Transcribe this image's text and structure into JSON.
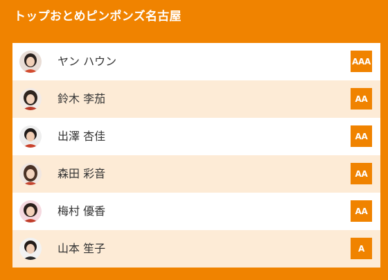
{
  "team": {
    "title": "トップおとめピンポンズ名古屋"
  },
  "players": [
    {
      "name": "ヤン ハウン",
      "rank": "AAA",
      "avatar_icon": "player-photo-icon"
    },
    {
      "name": "鈴木 李茄",
      "rank": "AA",
      "avatar_icon": "player-photo-icon"
    },
    {
      "name": "出澤 杏佳",
      "rank": "AA",
      "avatar_icon": "player-photo-icon"
    },
    {
      "name": "森田 彩音",
      "rank": "AA",
      "avatar_icon": "player-photo-icon"
    },
    {
      "name": "梅村 優香",
      "rank": "AA",
      "avatar_icon": "player-photo-icon"
    },
    {
      "name": "山本 笙子",
      "rank": "A",
      "avatar_icon": "player-photo-icon"
    }
  ],
  "colors": {
    "accent": "#f08300",
    "row_alt": "#fdebd6",
    "row": "#ffffff",
    "text": "#333333"
  }
}
